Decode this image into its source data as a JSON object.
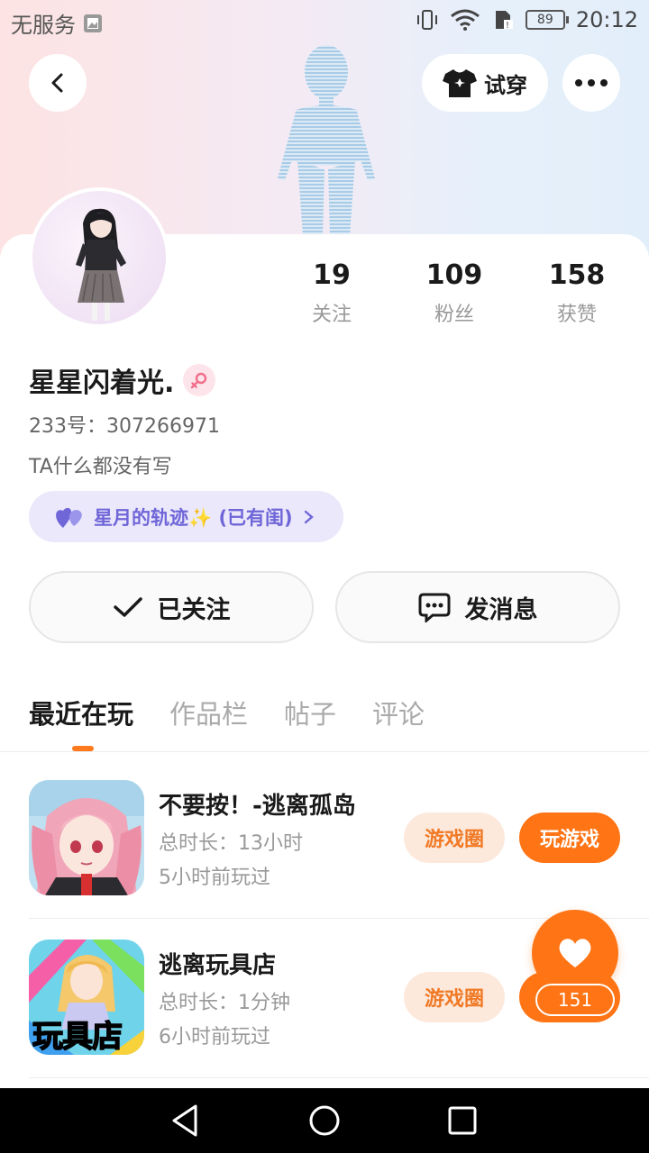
{
  "status_bar": {
    "carrier": "无服务",
    "battery": "89",
    "time": "20:12"
  },
  "header": {
    "try_on_label": "试穿"
  },
  "profile": {
    "stats": [
      {
        "value": "19",
        "label": "关注"
      },
      {
        "value": "109",
        "label": "粉丝"
      },
      {
        "value": "158",
        "label": "获赞"
      }
    ],
    "nickname": "星星闪着光.",
    "gender": "female",
    "uid": "233号：307266971",
    "bio": "TA什么都没有写",
    "track_pill": "星月的轨迹✨ (已有闺)"
  },
  "actions": {
    "follow_label": "已关注",
    "message_label": "发消息"
  },
  "tabs": [
    {
      "label": "最近在玩",
      "active": true
    },
    {
      "label": "作品栏",
      "active": false
    },
    {
      "label": "帖子",
      "active": false
    },
    {
      "label": "评论",
      "active": false
    }
  ],
  "games": [
    {
      "name": "不要按！-逃离孤岛",
      "duration": "总时长：13小时",
      "last_played": "5小时前玩过",
      "circle_label": "游戏圈",
      "play_label": "玩游戏"
    },
    {
      "name": "逃离玩具店",
      "icon_text": "玩具店",
      "duration": "总时长：1分钟",
      "last_played": "6小时前玩过",
      "circle_label": "游戏圈"
    }
  ],
  "like_button": {
    "count": "151"
  },
  "colors": {
    "accent": "#ff7414",
    "accent_soft": "#fde9dc",
    "track_purple": "#6f66d8"
  }
}
